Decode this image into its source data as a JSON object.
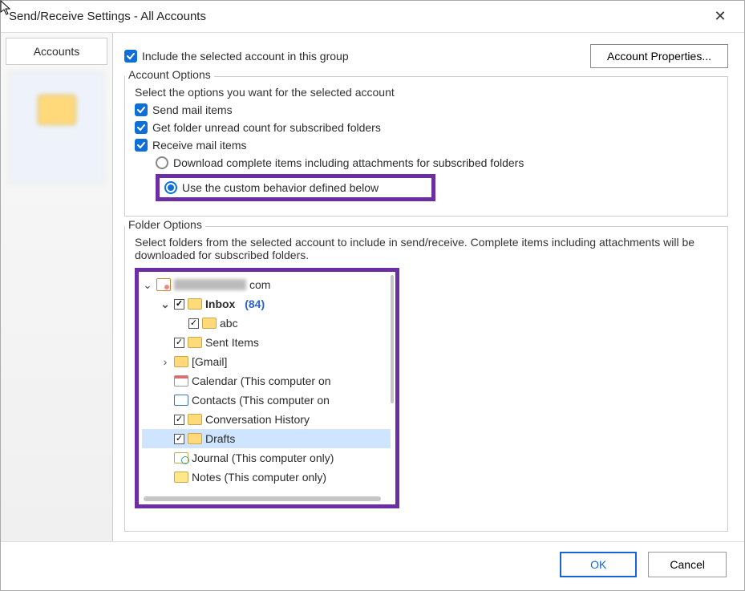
{
  "window": {
    "title": "Send/Receive Settings - All Accounts"
  },
  "sidebar": {
    "header": "Accounts"
  },
  "include_group": {
    "label": "Include the selected account in this group",
    "checked": true
  },
  "properties_button": "Account Properties...",
  "account_options": {
    "legend": "Account Options",
    "help": "Select the options you want for the selected account",
    "send_mail": {
      "label": "Send mail items",
      "checked": true
    },
    "unread_cnt": {
      "label": "Get folder unread count for subscribed folders",
      "checked": true
    },
    "recv_mail": {
      "label": "Receive mail items",
      "checked": true
    },
    "radio_download": {
      "label": "Download complete items including attachments for subscribed folders",
      "selected": false
    },
    "radio_custom": {
      "label": "Use the custom behavior defined below",
      "selected": true
    }
  },
  "folder_options": {
    "legend": "Folder Options",
    "help": "Select folders from the selected account to include in send/receive. Complete items including attachments will be downloaded for subscribed folders.",
    "root_suffix": "com",
    "tree": {
      "inbox": {
        "label": "Inbox",
        "count": "(84)",
        "checked": true
      },
      "inbox_abc": {
        "label": "abc",
        "checked": true
      },
      "sent": {
        "label": "Sent Items",
        "checked": true
      },
      "gmail": {
        "label": "[Gmail]"
      },
      "calendar": {
        "label": "Calendar (This computer on"
      },
      "contacts": {
        "label": "Contacts (This computer on"
      },
      "conv_hist": {
        "label": "Conversation History",
        "checked": true
      },
      "drafts": {
        "label": "Drafts",
        "checked": true,
        "selected": true
      },
      "journal": {
        "label": "Journal (This computer only)"
      },
      "notes": {
        "label": "Notes (This computer only)"
      }
    }
  },
  "buttons": {
    "ok": "OK",
    "cancel": "Cancel"
  }
}
